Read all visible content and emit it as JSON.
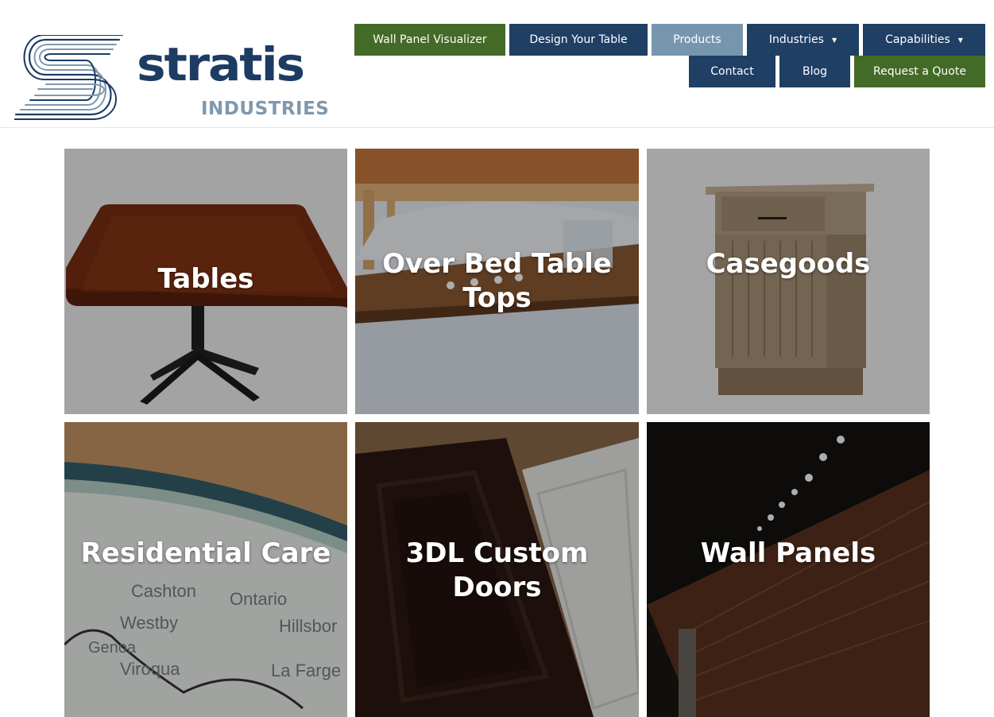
{
  "brand": {
    "name": "stratis",
    "sub": "INDUSTRIES"
  },
  "nav": {
    "row1": [
      {
        "label": "Wall Panel Visualizer",
        "color": "#436a26"
      },
      {
        "label": "Design Your Table",
        "color": "#1f3f64"
      },
      {
        "label": "Products",
        "color": "#7796ae"
      },
      {
        "label": "Industries",
        "color": "#1f3f64",
        "has_dropdown": true
      },
      {
        "label": "Capabilities",
        "color": "#1f3f64",
        "has_dropdown": true
      }
    ],
    "row2": [
      {
        "label": "Contact",
        "color": "#1f3f64"
      },
      {
        "label": "Blog",
        "color": "#1f3f64"
      },
      {
        "label": "Request a Quote",
        "color": "#436a26"
      }
    ],
    "dropdown_icon": "caret-down-icon"
  },
  "products": [
    {
      "label": "Tables",
      "image": "square wood table top on black pedestal base"
    },
    {
      "label": "Over Bed Table Tops",
      "image": "wood over-bed table with glass of water and pills"
    },
    {
      "label": "Casegoods",
      "image": "wood bedside cabinet with drawer"
    },
    {
      "label": "Residential Care",
      "image": "wood edge over printed map"
    },
    {
      "label": "3DL Custom Doors",
      "image": "dark and white raised panel cabinet doors"
    },
    {
      "label": "Wall Panels",
      "image": "wood slat wall panels with ceiling lights"
    }
  ],
  "map_words": [
    "Cashton",
    "Ontario",
    "Westby",
    "Hillsbor",
    "Viroqua",
    "La Farge",
    "Genoa"
  ],
  "colors": {
    "brand_navy": "#1c3c63",
    "brand_steel": "#7f98ad",
    "nav_green": "#436a26",
    "nav_navy": "#1f3f64",
    "nav_active": "#7796ae"
  }
}
